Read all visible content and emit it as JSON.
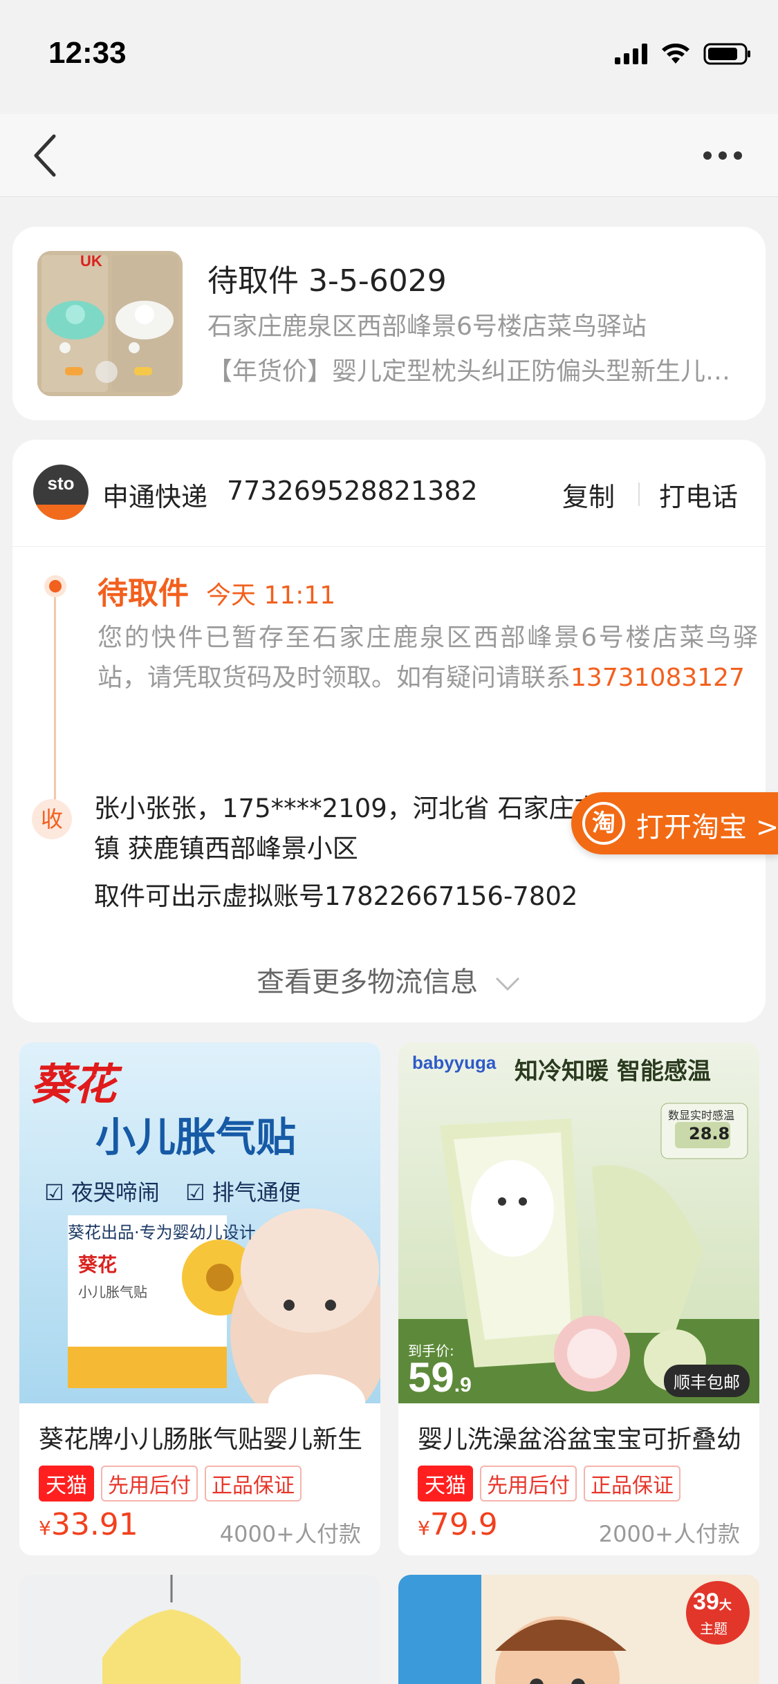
{
  "status_bar": {
    "time": "12:33",
    "icons": [
      "signal-icon",
      "wifi-icon",
      "battery-icon"
    ]
  },
  "nav": {
    "back_icon": "chevron-left-icon",
    "more_icon": "more-dots-icon"
  },
  "package": {
    "title": "待取件 3-5-6029",
    "address": "石家庄鹿泉区西部峰景6号楼店菜鸟驿站",
    "product": "【年货价】婴儿定型枕头纠正防偏头型新生儿宝宝",
    "thumb_text": "UK"
  },
  "courier": {
    "logo_text": "sto",
    "name": "申通快递",
    "tracking_number": "773269528821382",
    "copy_label": "复制",
    "call_label": "打电话"
  },
  "tracking": {
    "status": "待取件",
    "time": "今天 11:11",
    "description": "您的快件已暂存至石家庄鹿泉区西部峰景6号楼店菜鸟驿站，请凭取货码及时领取。如有疑问请联系",
    "phone": "13731083127"
  },
  "receiver": {
    "badge": "收",
    "info": "张小张张，175****2109，河北省 石家庄市 鹿泉区 获鹿镇 获鹿镇西部峰景小区",
    "virtual_account": "取件可出示虚拟账号17822667156-7802"
  },
  "more_logistics": "查看更多物流信息",
  "open_taobao": {
    "icon_text": "淘",
    "label": "打开淘宝 >"
  },
  "products": [
    {
      "name": "葵花牌小儿肠胀气贴婴儿新生",
      "tags": [
        "天猫",
        "先用后付",
        "正品保证"
      ],
      "currency": "¥",
      "price": "33.91",
      "sales": "4000+人付款",
      "img_brand": "葵花",
      "img_title": "小儿胀气贴",
      "img_check1": "夜哭啼闹",
      "img_check2": "排气通便",
      "img_sub": "葵花出品·专为婴幼儿设计",
      "img_box_brand": "葵花",
      "img_box_title": "小儿胀气贴"
    },
    {
      "name": "婴儿洗澡盆浴盆宝宝可折叠幼",
      "tags": [
        "天猫",
        "先用后付",
        "正品保证"
      ],
      "currency": "¥",
      "price": "79.9",
      "sales": "2000+人付款",
      "img_brand": "babyyuga",
      "img_slogan": "知冷知暖 智能感温",
      "img_display_label": "数显实时感温",
      "img_display_value": "28.8",
      "img_price_label": "到手价:",
      "img_price": "59",
      "img_price_suffix": ".9",
      "img_shipping": "顺丰包邮"
    }
  ],
  "product_row2": {
    "badge_big": "39",
    "badge_unit": "大",
    "badge_label": "主题"
  }
}
